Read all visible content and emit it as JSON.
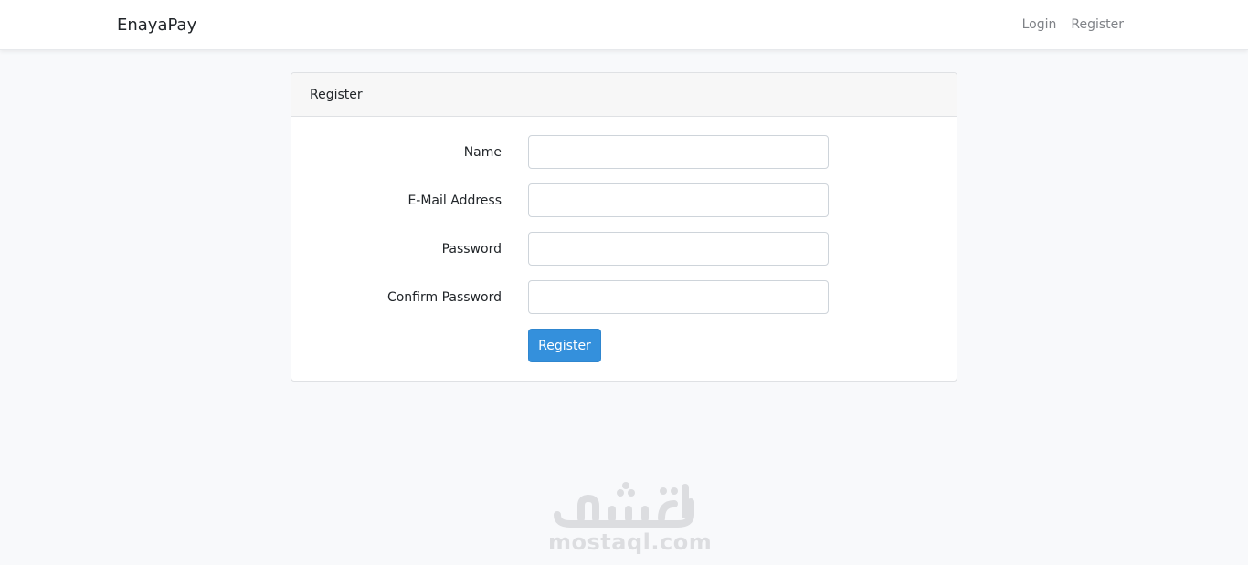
{
  "navbar": {
    "brand": "EnayaPay",
    "links": [
      {
        "label": "Login"
      },
      {
        "label": "Register"
      }
    ]
  },
  "card": {
    "title": "Register",
    "fields": [
      {
        "label": "Name",
        "value": ""
      },
      {
        "label": "E-Mail Address",
        "value": ""
      },
      {
        "label": "Password",
        "value": ""
      },
      {
        "label": "Confirm Password",
        "value": ""
      }
    ],
    "submit_label": "Register"
  },
  "watermark": {
    "logo_text": "مستقل",
    "text": "mostaql.com"
  },
  "colors": {
    "primary": "#3490dc",
    "page_bg": "#f8f9fb",
    "nav_link": "#7f8287"
  }
}
